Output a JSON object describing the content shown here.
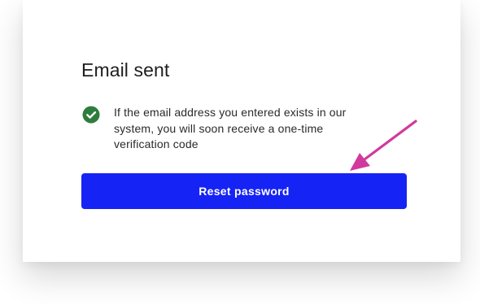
{
  "dialog": {
    "title": "Email sent",
    "message_lines": [
      "If the email address you entered exists in our",
      "system, you will soon receive a one-time",
      "verification code"
    ],
    "status_icon": "check-circle-icon",
    "button_label": "Reset password"
  },
  "annotation": {
    "icon": "arrow-icon"
  },
  "colors": {
    "button": "#1623f5",
    "success": "#2e7d3c",
    "arrow": "#d13a9c"
  }
}
